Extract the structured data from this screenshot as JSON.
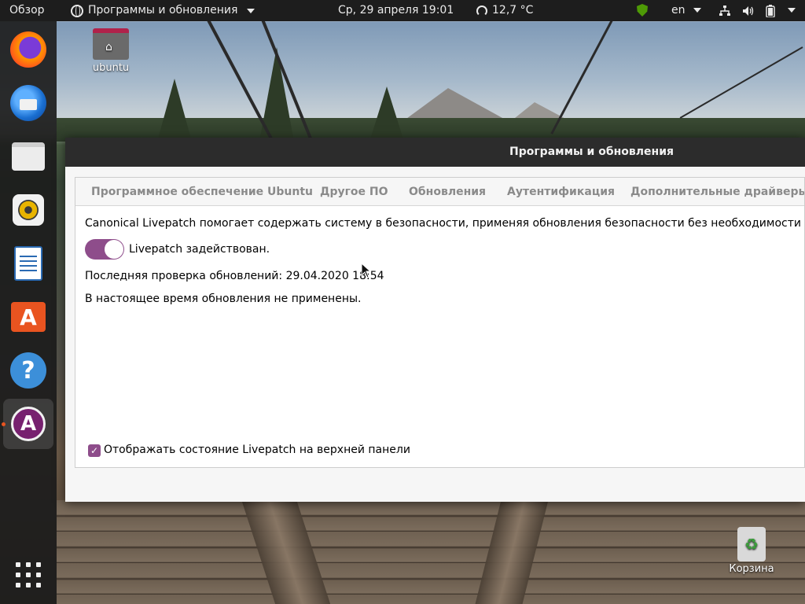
{
  "topbar": {
    "activities": "Обзор",
    "app_menu": "Программы и обновления",
    "clock": "Ср, 29 апреля  19:01",
    "weather": "12,7 °C",
    "lang": "en"
  },
  "dock": {
    "apps": [
      "firefox",
      "thunderbird",
      "files",
      "rhythmbox",
      "libreoffice-writer",
      "ubuntu-software",
      "help",
      "software-updater",
      "show-applications"
    ]
  },
  "desktop": {
    "home_label": "ubuntu",
    "trash_label": "Корзина"
  },
  "window": {
    "title": "Программы и обновления",
    "tabs": [
      {
        "label": "Программное обеспечение Ubuntu"
      },
      {
        "label": "Другое ПО"
      },
      {
        "label": "Обновления"
      },
      {
        "label": "Аутентификация"
      },
      {
        "label": "Дополнительные драйверы"
      }
    ],
    "description": "Canonical Livepatch помогает содержать систему в безопасности, применяя обновления безопасности без необходимости  перезагрузки.",
    "livepatch_switch_label": "Livepatch задействован.",
    "livepatch_enabled": true,
    "last_check": "Последняя проверка обновлений: 29.04.2020 18:54",
    "status": "В настоящее время обновления не применены.",
    "show_status_checkbox_label": "Отображать состояние Livepatch на верхней панели",
    "show_status_checked": true
  },
  "colors": {
    "accent": "#8e4d8b",
    "topbar": "#1d1d1d",
    "titlebar": "#2c2c2c",
    "dock_indicator": "#e95420"
  }
}
